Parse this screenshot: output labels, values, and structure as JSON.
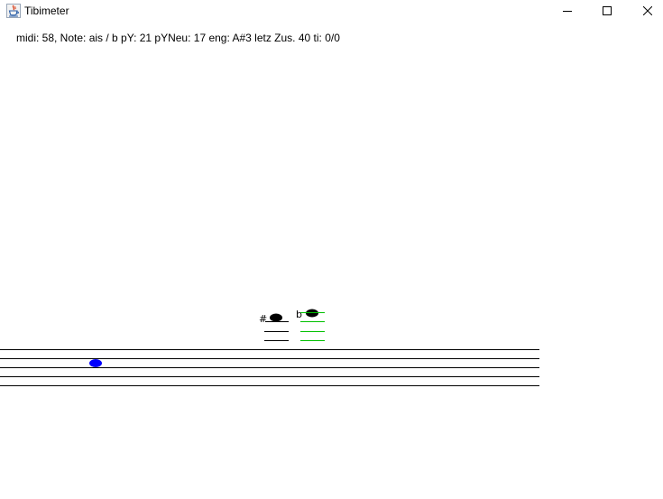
{
  "window": {
    "title": "Tibimeter",
    "icon": "java-cup-icon",
    "controls": [
      "minimize-icon",
      "maximize-icon",
      "close-icon"
    ]
  },
  "status": {
    "text": "midi: 58, Note: ais / b pY: 21 pYNeu: 17 eng: A#3 letz Zus. 40 ti: 0/0"
  },
  "notation": {
    "sharp_symbol": "#",
    "flat_symbol": "b",
    "current_note_color": "#0000ff",
    "reference_note_color": "#000000",
    "ledger_line_color": "#000000",
    "flat_ledger_line_color": "#00c000",
    "staff_line_count": 5
  }
}
